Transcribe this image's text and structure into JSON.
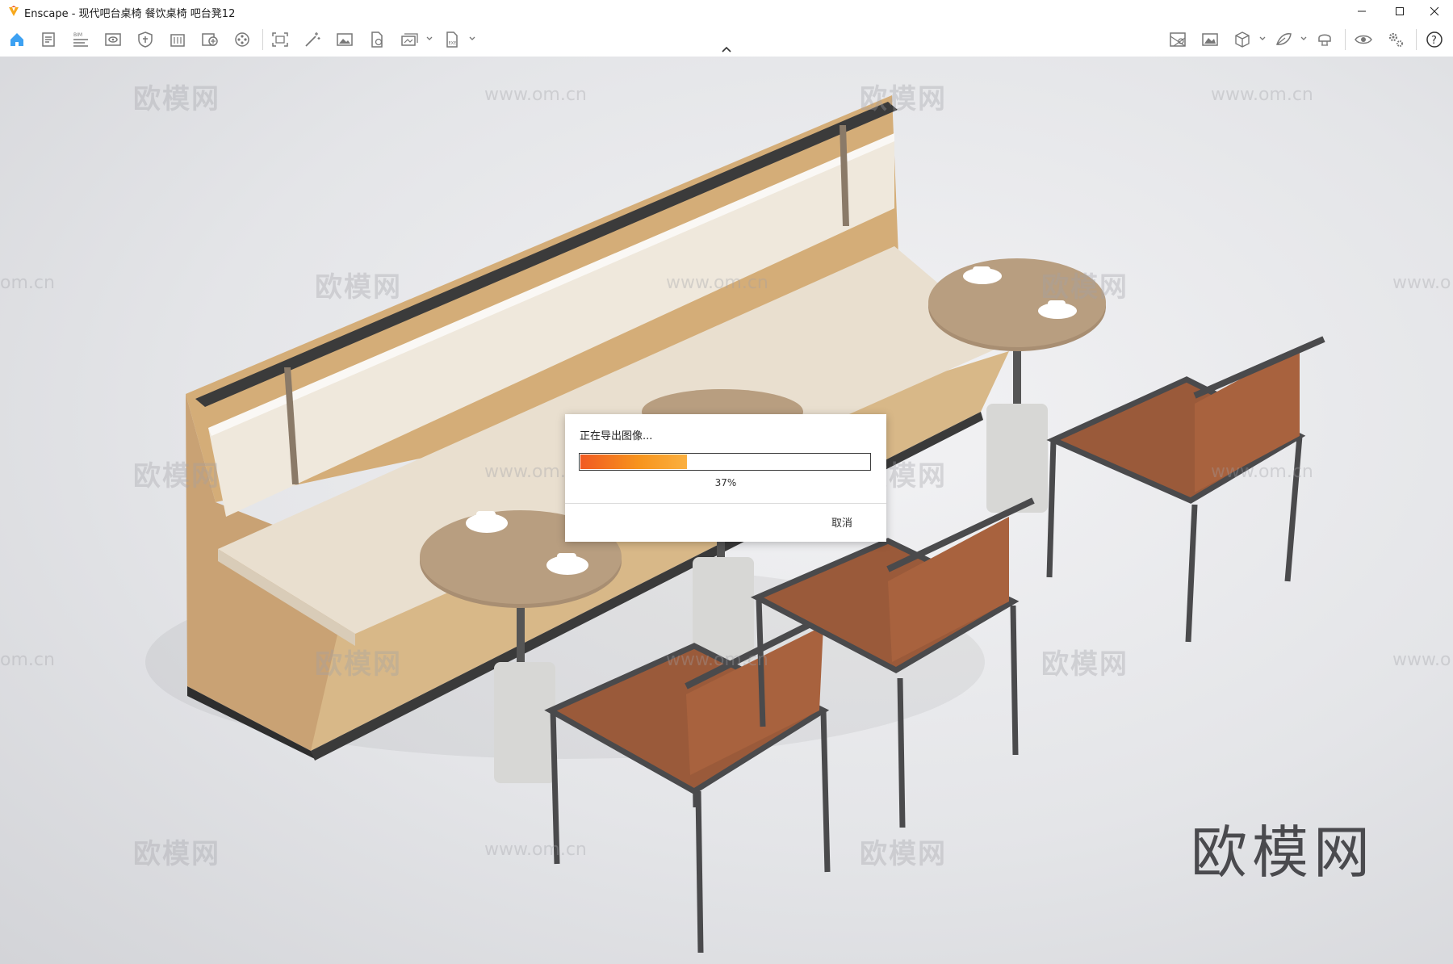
{
  "window": {
    "title": "Enscape - 现代吧台桌椅 餐饮桌椅 吧台凳12"
  },
  "toolbar": {
    "left_icons": [
      "home-icon",
      "document-icon",
      "bim-icon",
      "visual-settings-icon",
      "shield-icon",
      "building-icon",
      "asset-library-icon",
      "video-editor-icon",
      "screenshot-icon",
      "magic-wand-icon",
      "image-icon",
      "export-file-icon",
      "batch-render-icon",
      "exe-export-icon"
    ],
    "right_icons": [
      "map-icon",
      "panorama-icon",
      "cube-icon",
      "material-icon",
      "vr-headset-icon",
      "view-eye-icon",
      "settings-icon",
      "help-icon"
    ]
  },
  "dialog": {
    "message": "正在导出图像...",
    "progress_percent": 37,
    "progress_label": "37%",
    "cancel_label": "取消"
  },
  "watermarks": {
    "brand_cn": "欧模网",
    "site": "www.om.cn",
    "site_partial": "om.cn",
    "site_partial_right": "www.o"
  },
  "colors": {
    "accent": "#f7941d",
    "progress_start": "#f15a22",
    "logo": "#f7a81b"
  }
}
